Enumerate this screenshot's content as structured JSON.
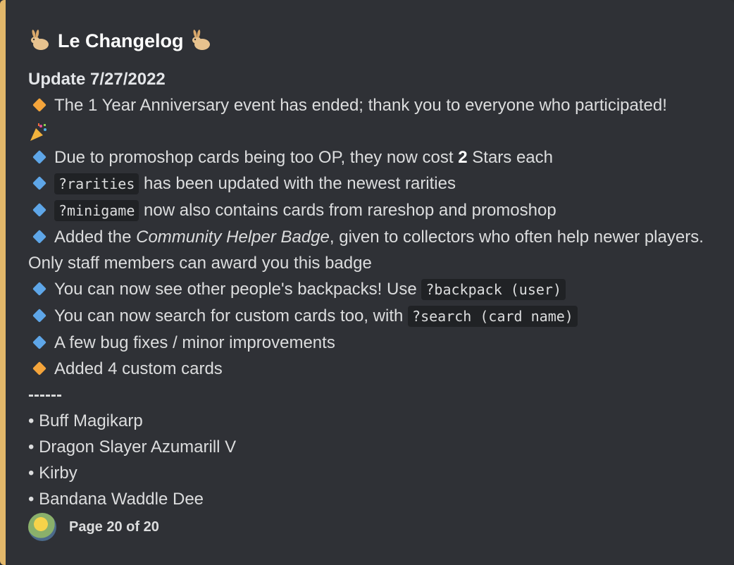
{
  "embed": {
    "accent_color": "#e2b76a",
    "title": "Le Changelog",
    "title_icon": "bunny-icon",
    "update_title": "Update 7/27/2022",
    "lines": [
      {
        "icon": "orange-diamond-icon",
        "text": "The 1 Year Anniversary event has ended; thank you to everyone who participated!"
      },
      {
        "icon": "blue-diamond-icon",
        "text_before": "Due to promoshop cards being too OP, they now cost ",
        "bold": "2",
        "text_after": " Stars each"
      },
      {
        "icon": "blue-diamond-icon",
        "code": "?rarities",
        "text": " has been updated with the newest rarities"
      },
      {
        "icon": "blue-diamond-icon",
        "code": "?minigame",
        "text": " now also contains cards from rareshop and promoshop"
      },
      {
        "icon": "blue-diamond-icon",
        "text_before": "Added the ",
        "italic": "Community Helper Badge",
        "text_after": ", given to collectors who often help newer players. Only staff members can award you this badge"
      },
      {
        "icon": "blue-diamond-icon",
        "text": "You can now see other people's backpacks! Use ",
        "code": "?backpack (user)"
      },
      {
        "icon": "blue-diamond-icon",
        "text": "You can now search for custom cards too, with ",
        "code": "?search (card name)"
      },
      {
        "icon": "blue-diamond-icon",
        "text": "A few bug fixes / minor improvements"
      },
      {
        "icon": "orange-diamond-icon",
        "text": "Added 4 custom cards"
      }
    ],
    "separator": "------",
    "cards": [
      "• Buff Magikarp",
      "• Dragon Slayer Azumarill V",
      "• Kirby",
      "• Bandana Waddle Dee"
    ],
    "footer": {
      "avatar_icon": "pikachu-avatar-icon",
      "text": "Page 20 of 20"
    }
  }
}
